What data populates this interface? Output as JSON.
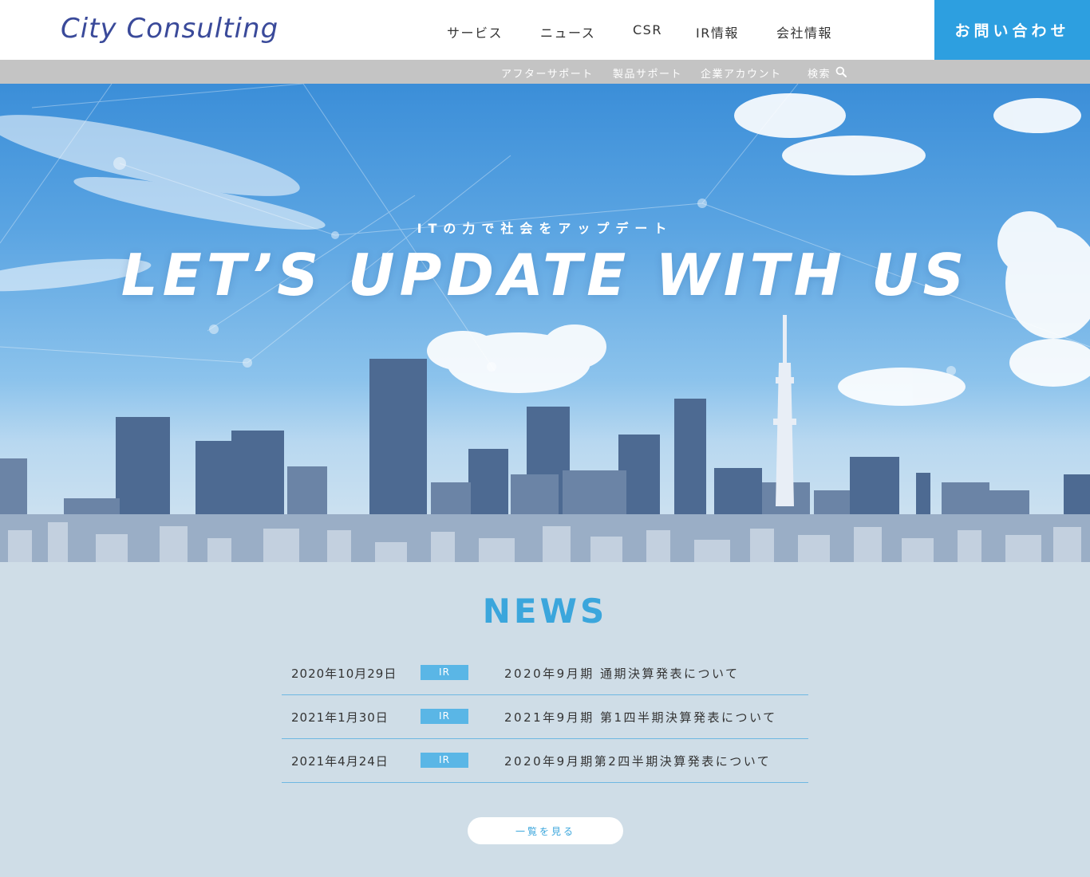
{
  "header": {
    "logo": "City Consulting",
    "nav": [
      "サービス",
      "ニュース",
      "CSR",
      "IR情報",
      "会社情報"
    ],
    "contact_label": "お問い合わせ"
  },
  "subnav": {
    "items": [
      "アフターサポート",
      "製品サポート",
      "企業アカウント"
    ],
    "search_label": "検索",
    "search_icon": "search-icon"
  },
  "hero": {
    "subtitle": "ITの力で社会をアップデート",
    "title": "LET’S UPDATE WITH US"
  },
  "news": {
    "title": "NEWS",
    "items": [
      {
        "date": "2020年10月29日",
        "tag": "IR",
        "text": "2020年9月期 通期決算発表について"
      },
      {
        "date": "2021年1月30日",
        "tag": "IR",
        "text": "2021年9月期 第1四半期決算発表について"
      },
      {
        "date": "2021年4月24日",
        "tag": "IR",
        "text": "2020年9月期第2四半期決算発表について"
      }
    ],
    "more_label": "一覧を見る"
  },
  "colors": {
    "accent": "#2d9fe0",
    "logo": "#3a4a9a",
    "news_title": "#3ba6dc",
    "tag": "#5ab6e6",
    "subnav_bg": "#c4c4c4",
    "page_bg": "#cfdde7"
  }
}
